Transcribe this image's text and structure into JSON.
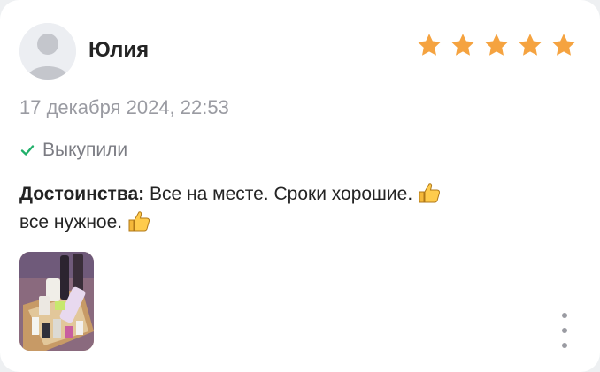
{
  "review": {
    "author": "Юлия",
    "rating": 5,
    "rating_max": 5,
    "date": "17 декабря 2024, 22:53",
    "status": "Выкупили",
    "pros_label": "Достоинства:",
    "text_line1": "Все на месте. Сроки хорошие.",
    "text_line2": "все нужное.",
    "photos_count": 1
  },
  "icons": {
    "star": "star-icon",
    "check": "check-icon",
    "thumbs": "thumbs-up-icon",
    "more": "more-vertical-icon",
    "avatar": "user-avatar-icon"
  },
  "colors": {
    "star": "#f5a340",
    "check": "#21b06a",
    "text": "#242424",
    "muted": "#9a9ba2"
  }
}
